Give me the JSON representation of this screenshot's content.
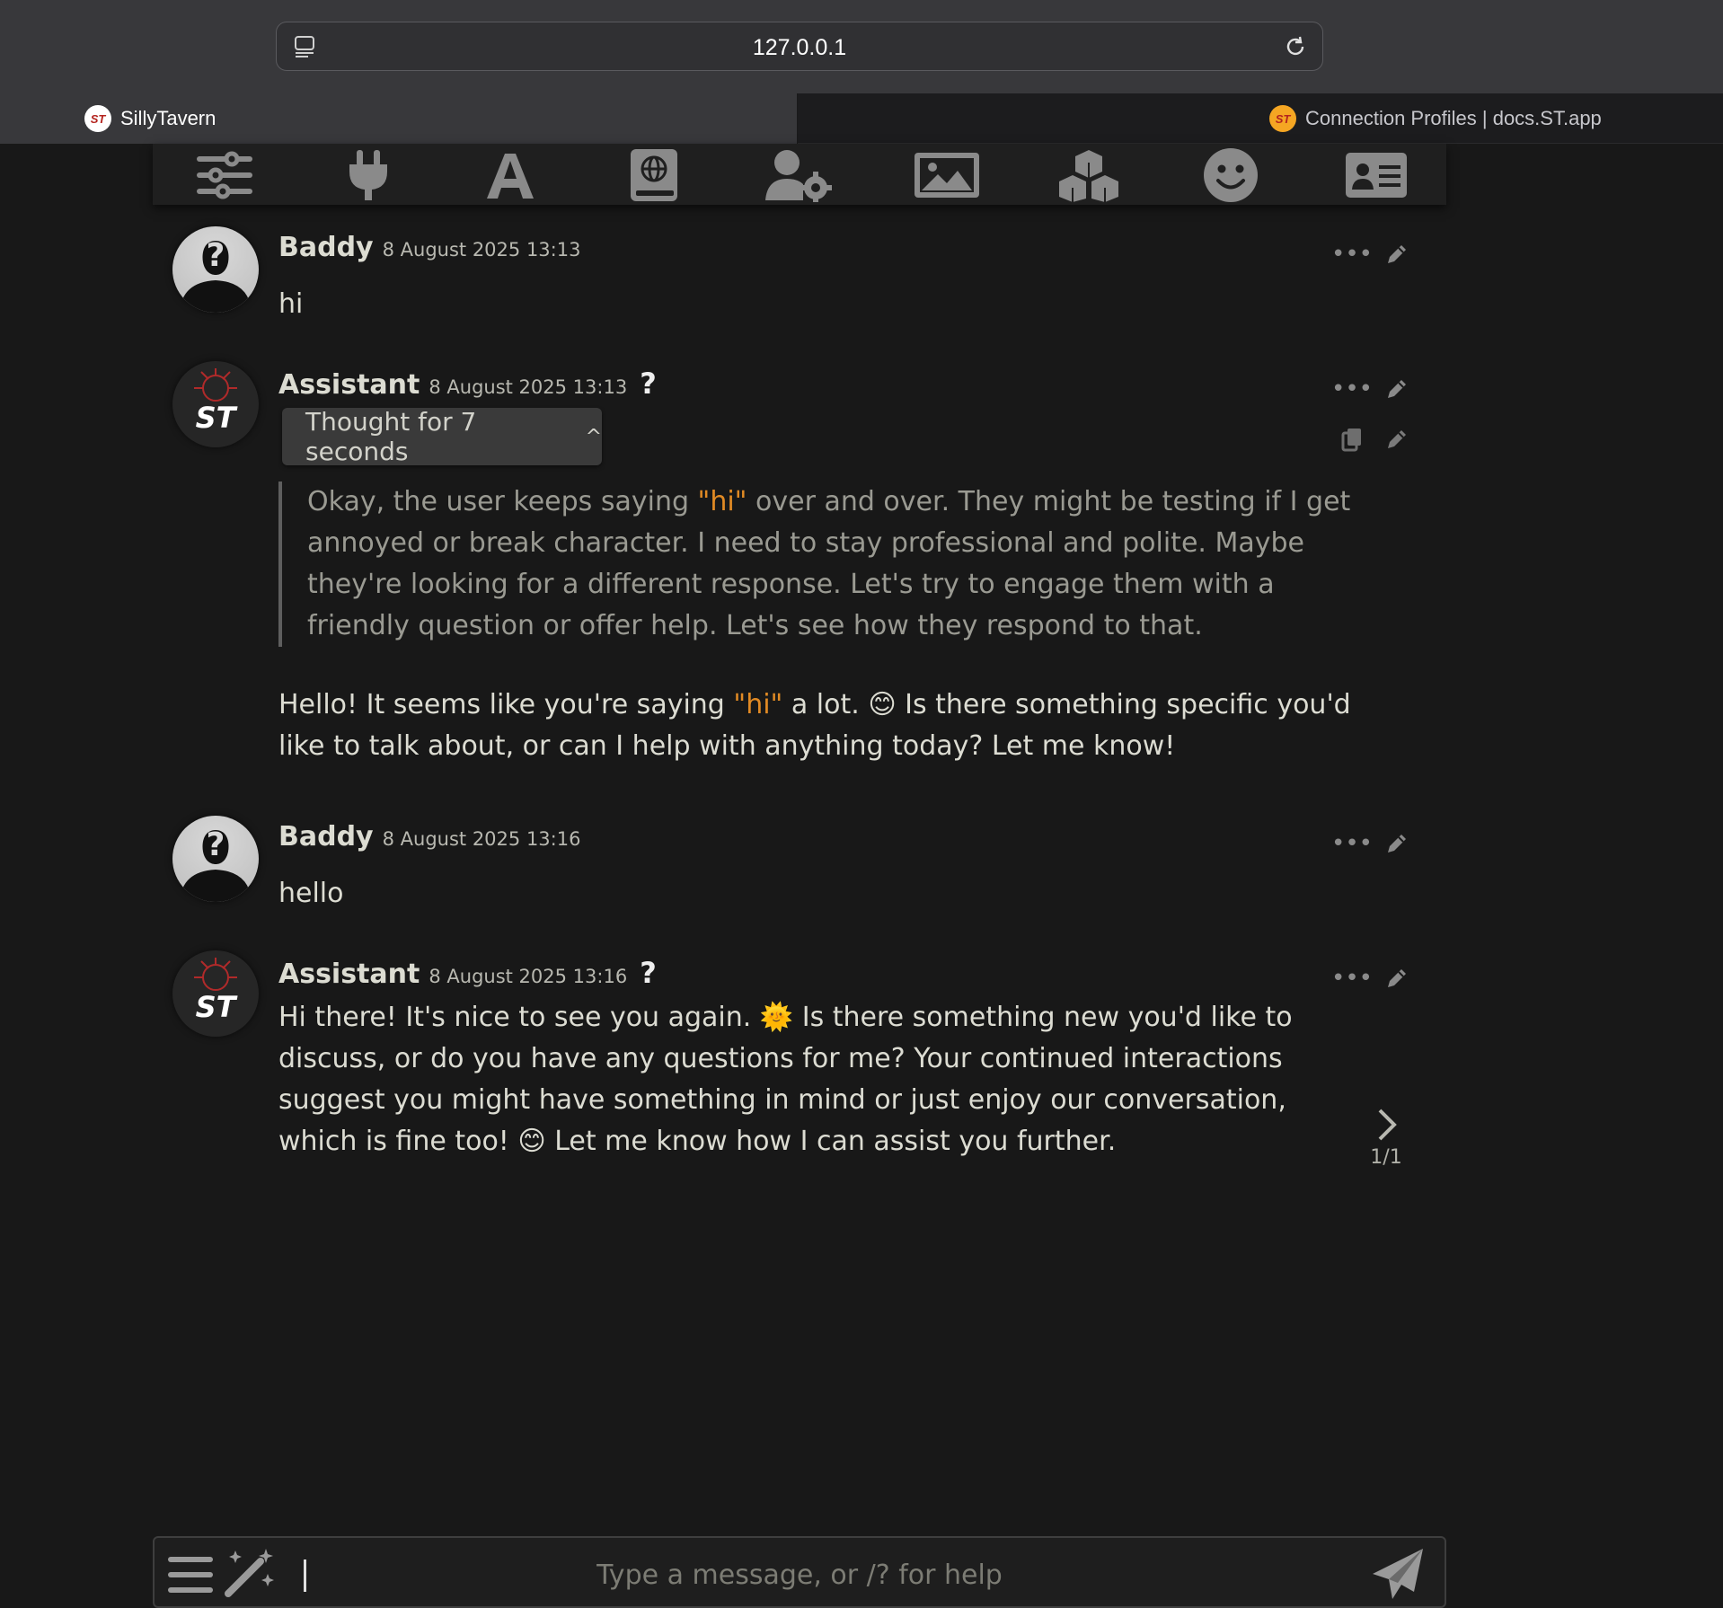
{
  "browser": {
    "url": "127.0.0.1",
    "tabs": [
      {
        "label": "SillyTavern",
        "favicon": "ST"
      },
      {
        "label": "Connection Profiles | docs.ST.app",
        "favicon": "ST"
      }
    ]
  },
  "toolbar": {
    "icons": [
      "sliders-icon",
      "plug-icon",
      "font-icon",
      "world-book-icon",
      "user-settings-icon",
      "image-icon",
      "cubes-icon",
      "smile-icon",
      "character-card-icon"
    ]
  },
  "messages": [
    {
      "author": "Baddy",
      "time": "8 August 2025 13:13",
      "text": "hi"
    },
    {
      "author": "Assistant",
      "time": "8 August 2025 13:13",
      "help": "?",
      "thought_label": "Thought for 7 seconds",
      "thought_pre": "Okay, the user keeps saying ",
      "thought_quote": "\"hi\"",
      "thought_post": " over and over. They might be testing if I get annoyed or break character. I need to stay professional and polite. Maybe they're looking for a different response. Let's try to engage them with a friendly question or offer help. Let's see how they respond to that.",
      "text_pre": "Hello! It seems like you're saying ",
      "text_quote": "\"hi\"",
      "text_mid": " a lot. ",
      "text_emoji": "😊",
      "text_post": " Is there something specific you'd like to talk about, or can I help with anything today? Let me know!"
    },
    {
      "author": "Baddy",
      "time": "8 August 2025 13:16",
      "text": "hello"
    },
    {
      "author": "Assistant",
      "time": "8 August 2025 13:16",
      "help": "?",
      "text_a": "Hi there! It's nice to see you again. ",
      "emoji_a": "🌞",
      "text_b": " Is there something new you'd like to discuss, or do you have any questions for me? Your continued interactions suggest you might have something in mind or just enjoy our conversation, which is fine too! ",
      "emoji_b": "😊",
      "text_c": " Let me know how I can assist you further.",
      "swipe_count": "1/1"
    }
  ],
  "input": {
    "placeholder": "Type a message, or /? for help"
  },
  "colors": {
    "background": "#181818",
    "accent_quote": "#e18a24",
    "text": "#dcdcd2",
    "thought_text": "#9a9a92"
  }
}
